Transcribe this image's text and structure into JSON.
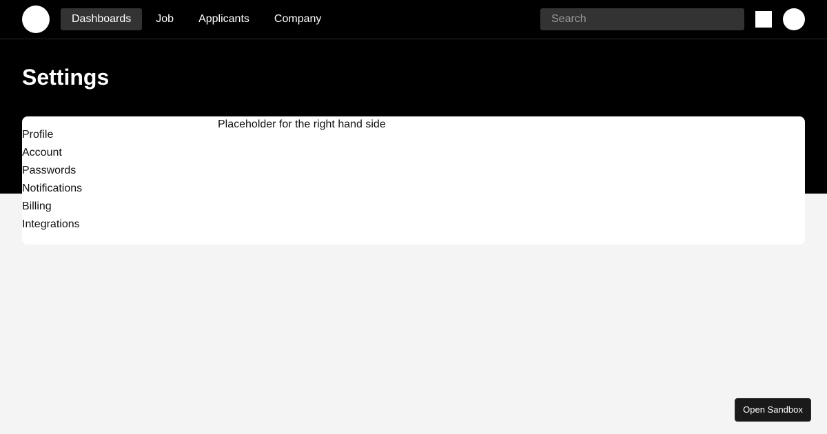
{
  "header": {
    "nav": [
      {
        "label": "Dashboards",
        "active": true
      },
      {
        "label": "Job",
        "active": false
      },
      {
        "label": "Applicants",
        "active": false
      },
      {
        "label": "Company",
        "active": false
      }
    ],
    "search": {
      "placeholder": "Search",
      "value": ""
    }
  },
  "page": {
    "title": "Settings"
  },
  "settings_nav": {
    "items": [
      {
        "label": "Profile"
      },
      {
        "label": "Account"
      },
      {
        "label": "Passwords"
      },
      {
        "label": "Notifications"
      },
      {
        "label": "Billing"
      },
      {
        "label": "Integrations"
      }
    ]
  },
  "content": {
    "placeholder": "Placeholder for the right hand side"
  },
  "sandbox": {
    "label": "Open Sandbox"
  },
  "colors": {
    "header_bg": "#000000",
    "page_bg": "#f4f4f4",
    "active_nav_bg": "#333333"
  }
}
